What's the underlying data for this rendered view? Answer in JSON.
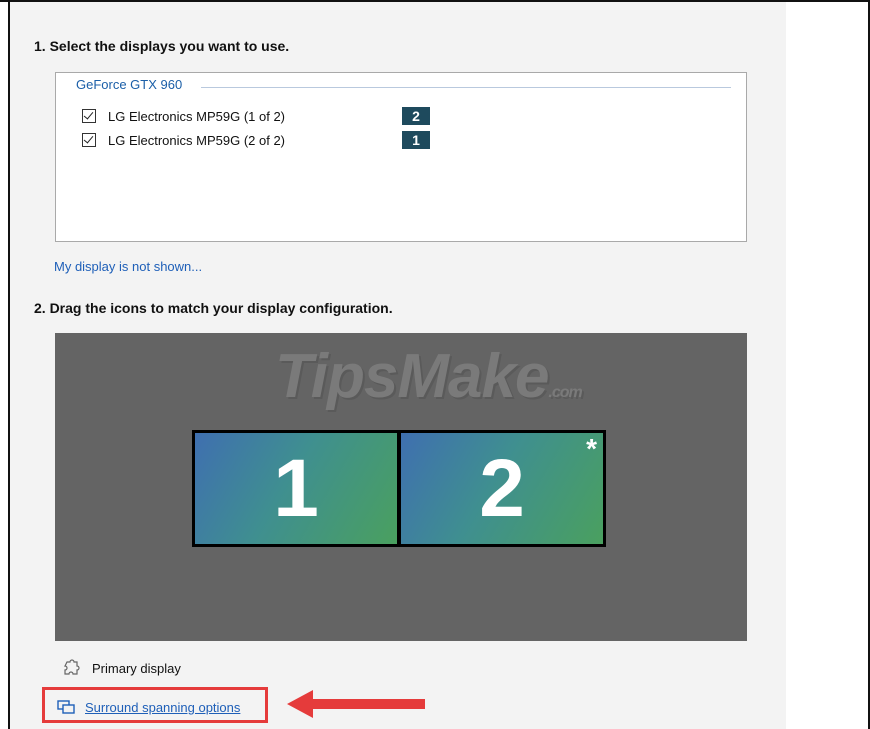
{
  "step1": {
    "title": "1. Select the displays you want to use."
  },
  "gpu_group": {
    "label": "GeForce GTX 960",
    "displays": [
      {
        "label": "LG Electronics MP59G (1 of 2)",
        "checked": true,
        "badge": "2"
      },
      {
        "label": "LG Electronics MP59G (2 of 2)",
        "checked": true,
        "badge": "1"
      }
    ]
  },
  "not_shown_link": "My display is not shown...",
  "step2": {
    "title": "2. Drag the icons to match your display configuration."
  },
  "canvas": {
    "watermark_main": "TipsMake",
    "watermark_suffix": ".com",
    "monitors": [
      {
        "number": "1",
        "primary": false
      },
      {
        "number": "2",
        "primary": true,
        "primary_mark": "*"
      }
    ]
  },
  "legend": {
    "primary_label": "Primary display",
    "icon": "puzzle-icon"
  },
  "surround": {
    "label": "Surround spanning options",
    "icon": "surround-icon"
  },
  "annotation": {
    "highlight_color": "#e53b3b"
  },
  "colors": {
    "link": "#1e5fb8",
    "badge_bg": "#1e4a5d",
    "canvas_bg": "#646464"
  }
}
